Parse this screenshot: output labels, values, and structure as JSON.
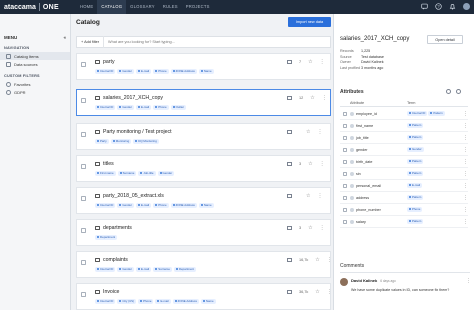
{
  "topbar": {
    "brand": "ataccama",
    "product": "ONE",
    "nav": [
      "HOME",
      "CATALOG",
      "GLOSSARY",
      "RULES",
      "PROJECTS"
    ],
    "active_nav": "CATALOG",
    "icons": [
      "chat-icon",
      "help-icon",
      "notifications-icon",
      "avatar"
    ]
  },
  "sidebar": {
    "menu_label": "MENU",
    "sections": [
      {
        "title": "NAVIGATION",
        "items": [
          "Catalog Items",
          "Data sources"
        ]
      },
      {
        "title": "CUSTOM FILTERS",
        "items": [
          "Favorites",
          "GDPR"
        ]
      }
    ]
  },
  "catalog": {
    "title": "Catalog",
    "import_label": "Import new data",
    "add_filter_label": "+ Add filter",
    "search_placeholder": "What are you looking for? Start typing...",
    "items": [
      {
        "name": "party",
        "count": "7",
        "tags": [
          "Internal ID",
          "Gender",
          "E-mail",
          "Phone",
          "ZONE Address",
          "Name"
        ]
      },
      {
        "name": "salaries_2017_XCH_copy",
        "count": "12",
        "tags": [
          "Internal ID",
          "Gender",
          "E-mail",
          "Phone",
          "Outlier"
        ]
      },
      {
        "name": "Party monitoring / Test project",
        "count": "",
        "tags": [
          "Party",
          "Monitoring",
          "DQ Monitoring"
        ]
      },
      {
        "name": "titles",
        "count": "3",
        "tags": [
          "First name",
          "Surname",
          "Job-title",
          "Gender"
        ]
      },
      {
        "name": "party_2018_05_extract.xls",
        "count": "",
        "tags": [
          "Internal ID",
          "Gender",
          "E-mail",
          "Phone",
          "ZONE Address",
          "Name"
        ]
      },
      {
        "name": "departments",
        "count": "3",
        "tags": [
          "Department"
        ]
      },
      {
        "name": "complaints",
        "count": "16,7k",
        "tags": [
          "Internal ID",
          "Gender",
          "E-mail",
          "Surname",
          "Department"
        ]
      },
      {
        "name": "Invoice",
        "count": "36,7k",
        "tags": [
          "Internal ID",
          "City (US)",
          "Phone",
          "E-mail",
          "ZONE Address",
          "Name"
        ]
      }
    ]
  },
  "detail": {
    "title": "salaries_2017_XCH_copy",
    "open_label": "Open detail",
    "info": [
      {
        "k": "Records",
        "v": "1,225"
      },
      {
        "k": "Source",
        "v": "Test database"
      },
      {
        "k": "Owner",
        "v": "David Kalinek"
      },
      {
        "k": "Last profiled",
        "v": "3 months ago"
      }
    ],
    "attributes_label": "Attributes",
    "attr_col": "Attribute",
    "term_col": "Term",
    "attributes": [
      {
        "name": "employee_id",
        "terms": [
          "Internal ID",
          "Pattern"
        ]
      },
      {
        "name": "first_name",
        "terms": [
          "Pattern"
        ]
      },
      {
        "name": "job_title",
        "terms": [
          "Pattern"
        ]
      },
      {
        "name": "gender",
        "terms": [
          "Gender"
        ]
      },
      {
        "name": "birth_date",
        "terms": [
          "Pattern"
        ]
      },
      {
        "name": "sin",
        "terms": [
          "Pattern"
        ]
      },
      {
        "name": "personal_email",
        "terms": [
          "E-mail"
        ]
      },
      {
        "name": "address",
        "terms": [
          "Pattern"
        ]
      },
      {
        "name": "phone_number",
        "terms": [
          "Phone"
        ]
      },
      {
        "name": "salary",
        "terms": [
          "Pattern"
        ]
      }
    ],
    "comments_label": "Comments",
    "comment": {
      "user": "David Kalinek",
      "time": "6 days ago",
      "text": "We have some duplicate values in ID, can someone fix them?"
    }
  }
}
